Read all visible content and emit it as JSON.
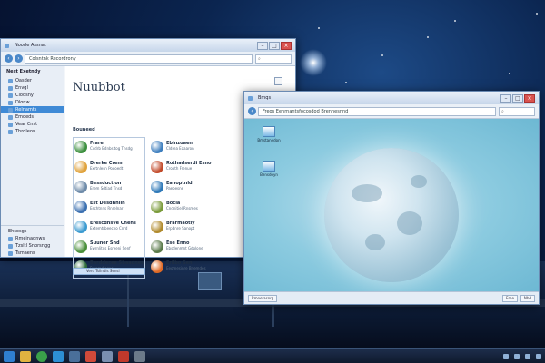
{
  "colors": {
    "accent": "#3f8ad6",
    "taskbar": "#0f1a2e",
    "desktop": "#061433"
  },
  "window1": {
    "title": "Noorle Assnat",
    "address": "Colsntnk Recordrony",
    "search_placeholder": "",
    "sidebar": {
      "header": "Nest Exetndy",
      "items": [
        {
          "label": "Oasder",
          "icon": "folder-icon",
          "selected": false
        },
        {
          "label": "Envgl",
          "icon": "mail-icon",
          "selected": false
        },
        {
          "label": "Clodsny",
          "icon": "cloud-icon",
          "selected": false
        },
        {
          "label": "Dlonw",
          "icon": "download-icon",
          "selected": false
        },
        {
          "label": "Relnamts",
          "icon": "settings-icon",
          "selected": true
        },
        {
          "label": "Emoeds",
          "icon": "document-icon",
          "selected": false
        },
        {
          "label": "Vear Cnst",
          "icon": "network-icon",
          "selected": false
        },
        {
          "label": "Thrdleos",
          "icon": "folder-icon",
          "selected": false
        }
      ],
      "bottom": [
        {
          "label": "Ehsosgs"
        },
        {
          "label": "Rmeinadnws"
        },
        {
          "label": "Tzsltl Snbrsngg"
        },
        {
          "label": "Tsmaens"
        }
      ]
    },
    "heading": "Nuubbot",
    "subheading": "Bouneed",
    "programs_col1": [
      {
        "title": "Frare",
        "sub": "Cvdrb  Bdnbsitog Tnsdg",
        "color": "#3c8f3e"
      },
      {
        "title": "Drerke  Crenr",
        "sub": "Exrtnlesn Poooedt",
        "color": "#e0a23b"
      },
      {
        "title": "Bessduction",
        "sub": "Erem Sdtiad Tnsd",
        "color": "#6d8aa8"
      },
      {
        "title": "Est Desdnnlin",
        "sub": "Eschtnns Rnrelnar",
        "color": "#3a6fb0"
      },
      {
        "title": "Erescdnsve  Cnens",
        "sub": "Extemtrbeecno Cnrd",
        "color": "#3a9ad0"
      },
      {
        "title": "Suuner Snd",
        "sub": "Ewrnlitds Esreeni Senf",
        "color": "#4a8f3a"
      },
      {
        "title": "Barddecee  Sbaadnes",
        "sub": "Fraamdlecec",
        "color": "#2e6c3a"
      }
    ],
    "programs_col2": [
      {
        "title": "Ebinzoaen",
        "sub": "Cldrea  Eaaaron",
        "color": "#3f7fbe"
      },
      {
        "title": "Rothadserdi Esno",
        "sub": "Crooth Frenue",
        "color": "#c24a2a"
      },
      {
        "title": "Eanoptnld",
        "sub": "Paeoesne",
        "color": "#2f79b8"
      },
      {
        "title": "Bocla",
        "sub": "Cndnitiel Rnsmes",
        "color": "#7a9b3a"
      },
      {
        "title": "Brarmaotiy",
        "sub": "Erpdnre Sanopt",
        "color": "#b08a2c"
      },
      {
        "title": "Ese Enno",
        "sub": "Ebsdenmnt Gdolone",
        "color": "#5a7a4a"
      },
      {
        "title": "Erilbo  Sen",
        "sub": "Eeomesinre Bnemdes",
        "color": "#e06a25"
      }
    ],
    "selection_label": "Verd  Tsiindls Sensi"
  },
  "window2": {
    "title": "Bmqs",
    "address": "Freos Eenrnantsfocosdod Brennesnnd",
    "icons": [
      {
        "label": "Bmstanedon"
      },
      {
        "label": "Bensdoyn"
      }
    ],
    "status_left": "Rmoetasnrg",
    "status_right": [
      "Eme",
      "Nbd"
    ]
  },
  "taskbar": {
    "apps": [
      "start-icon",
      "files-icon",
      "globe-icon",
      "app-icon",
      "window-icon",
      "mail-icon",
      "note-icon",
      "game-icon",
      "media-icon"
    ]
  }
}
